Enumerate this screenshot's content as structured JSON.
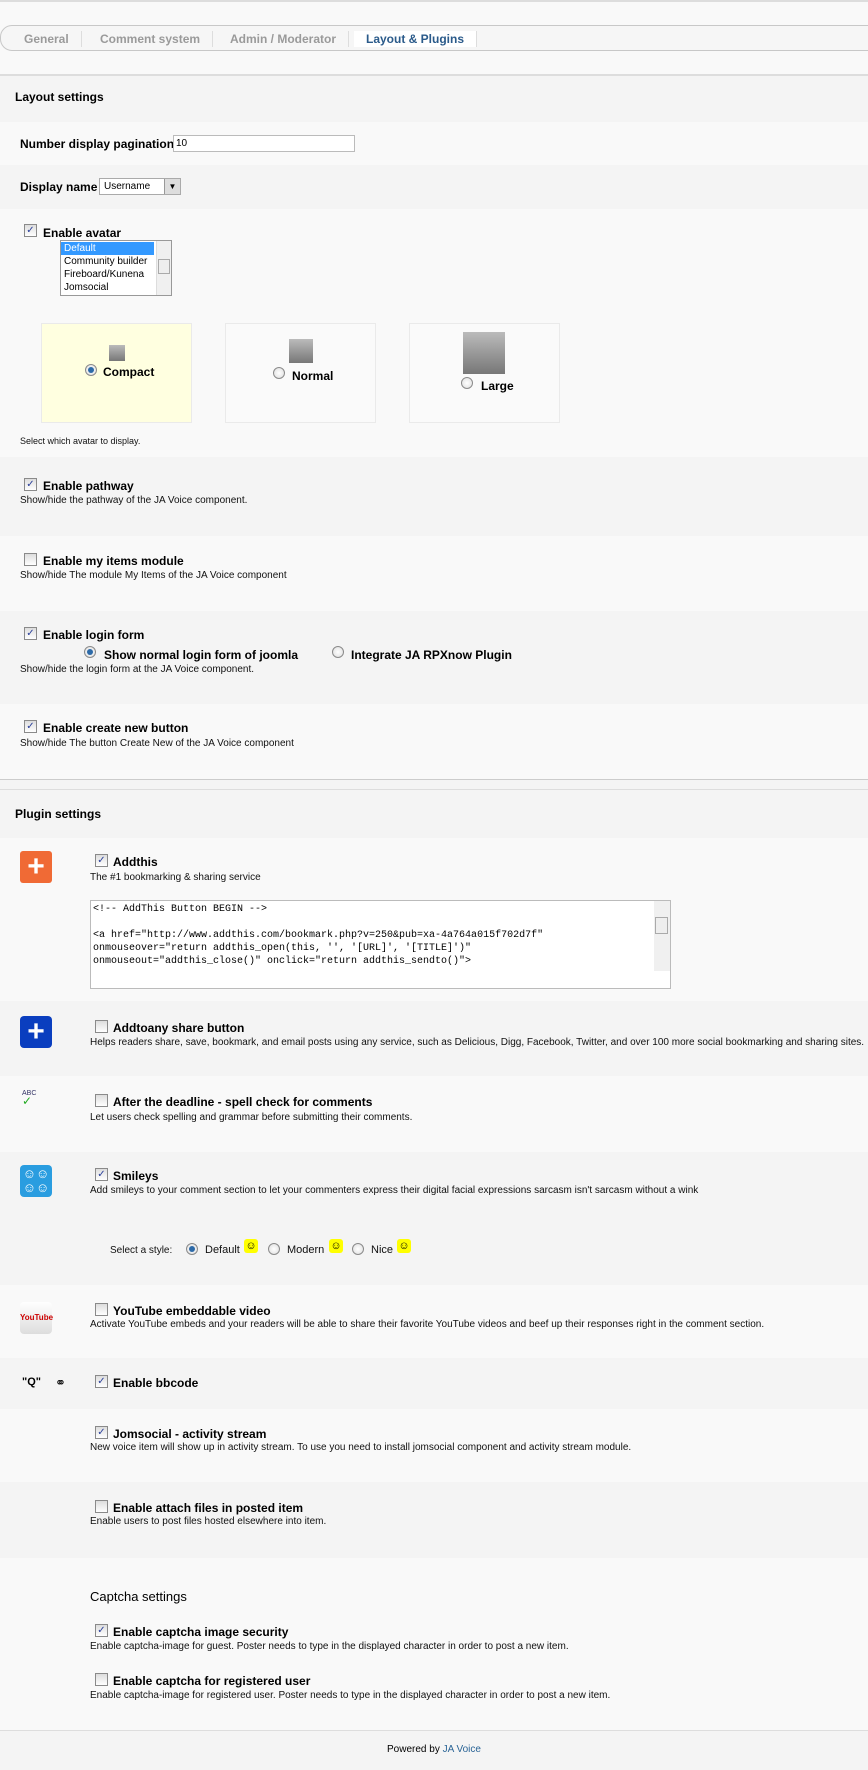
{
  "tabs": [
    {
      "label": "General"
    },
    {
      "label": "Comment system"
    },
    {
      "label": "Admin / Moderator"
    },
    {
      "label": "Layout & Plugins",
      "active": true
    }
  ],
  "layout": {
    "heading": "Layout settings",
    "pagination": {
      "label": "Number display pagination",
      "value": "10"
    },
    "display_name": {
      "label": "Display name",
      "value": "Username"
    },
    "avatar": {
      "label": "Enable avatar",
      "checked": true,
      "options": [
        "Default",
        "Community builder",
        "Fireboard/Kunena",
        "Jomsocial"
      ],
      "selected": "Default",
      "sizes": [
        {
          "label": "Compact",
          "selected": true
        },
        {
          "label": "Normal",
          "selected": false
        },
        {
          "label": "Large",
          "selected": false
        }
      ],
      "help": "Select which avatar to display."
    },
    "pathway": {
      "label": "Enable pathway",
      "checked": true,
      "desc": "Show/hide the pathway of the JA Voice component."
    },
    "my_items": {
      "label": "Enable my items module",
      "checked": false,
      "desc": "Show/hide The module My Items of the JA Voice component"
    },
    "login": {
      "label": "Enable login form",
      "checked": true,
      "opt1": "Show normal login form of joomla",
      "opt2": "Integrate JA RPXnow Plugin",
      "selected": "opt1",
      "desc": "Show/hide the login form at the JA Voice component."
    },
    "create_new": {
      "label": "Enable create new button",
      "checked": true,
      "desc": "Show/hide The button Create New of the JA Voice component"
    }
  },
  "plugins": {
    "heading": "Plugin settings",
    "addthis": {
      "label": "Addthis",
      "checked": true,
      "icon": "plus-orange-icon",
      "desc": "The #1 bookmarking & sharing service",
      "code": "<!-- AddThis Button BEGIN -->\n\n<a href=\"http://www.addthis.com/bookmark.php?v=250&pub=xa-4a764a015f702d7f\"\nonmouseover=\"return addthis_open(this, '', '[URL]', '[TITLE]')\"\nonmouseout=\"addthis_close()\" onclick=\"return addthis_sendto()\">"
    },
    "addtoany": {
      "label": "Addtoany share button",
      "checked": false,
      "icon": "plus-blue-icon",
      "desc": "Helps readers share, save, bookmark, and email posts using any service, such as Delicious, Digg, Facebook, Twitter, and over 100 more social bookmarking and sharing sites."
    },
    "deadline": {
      "label": "After the deadline - spell check for comments",
      "checked": false,
      "icon": "spellcheck-icon",
      "icon_text": "ABC",
      "desc": "Let users check spelling and grammar before submitting their comments."
    },
    "smileys": {
      "label": "Smileys",
      "checked": true,
      "icon": "smileys-icon",
      "desc": "Add smileys to your comment section to let your commenters express their digital facial expressions sarcasm isn't sarcasm without a wink",
      "style_label": "Select a style:",
      "styles": [
        {
          "label": "Default",
          "selected": true
        },
        {
          "label": "Modern",
          "selected": false
        },
        {
          "label": "Nice",
          "selected": false
        }
      ]
    },
    "youtube": {
      "label": "YouTube embeddable video",
      "checked": false,
      "icon": "youtube-icon",
      "icon_text": "YouTube",
      "desc": "Activate YouTube embeds and your readers will be able to share their favorite YouTube videos and beef up their responses right in the comment section."
    },
    "bbcode": {
      "label": "Enable bbcode",
      "checked": true,
      "icon": "quote-link-icon",
      "quote_glyph": "\"Q\""
    },
    "jomsocial": {
      "label": "Jomsocial - activity stream",
      "checked": true,
      "desc": "New voice item will show up in activity stream. To use you need to install jomsocial component and activity stream module."
    },
    "attach": {
      "label": "Enable attach files in posted item",
      "checked": false,
      "desc": "Enable users to post files hosted elsewhere into item."
    }
  },
  "captcha": {
    "heading": "Captcha settings",
    "image": {
      "label": "Enable captcha image security",
      "checked": true,
      "desc": "Enable captcha-image for guest. Poster needs to type in the displayed character in order to post a new item."
    },
    "registered": {
      "label": "Enable captcha for registered user",
      "checked": false,
      "desc": "Enable captcha-image for registered user. Poster needs to type in the displayed character in order to post a new item."
    }
  },
  "footer": {
    "prefix": "Powered by",
    "link": "JA Voice",
    "link_color": "#2a6496"
  },
  "colors": {
    "accent": "#2a5a8a",
    "row_dark": "#f4f4f4",
    "row_light": "#f9f9f9",
    "selection": "#3399ff",
    "avatar_highlight": "#ffffe0"
  }
}
